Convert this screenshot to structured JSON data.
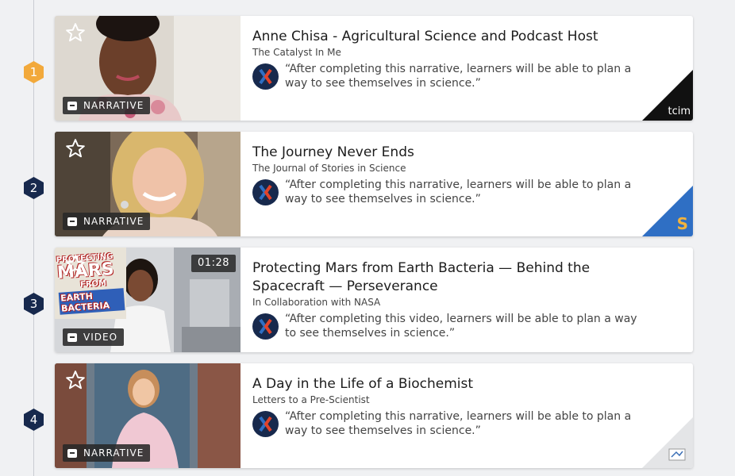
{
  "cards": [
    {
      "step": "1",
      "title": "Anne Chisa - Agricultural Science and Podcast Host",
      "source": "The Catalyst In Me",
      "objective": "“After completing this narrative, learners will be able to plan a way to see themselves in science.”",
      "type_label": "NARRATIVE",
      "corner_label": "tcim"
    },
    {
      "step": "2",
      "title": "The Journey Never Ends",
      "source": "The Journal of Stories in Science",
      "objective": "“After completing this narrative, learners will be able to plan a way to see themselves in science.”",
      "type_label": "NARRATIVE",
      "corner_label": "S"
    },
    {
      "step": "3",
      "title": "Protecting Mars from Earth Bacteria — Behind the Spacecraft — Perseverance",
      "source": "In Collaboration with NASA",
      "objective": "“After completing this video, learners will be able to plan a way to see themselves in science.”",
      "type_label": "VIDEO",
      "duration": "01:28",
      "poster_lines": [
        "PROTECTING",
        "MARS",
        "FROM",
        "EARTH BACTERIA"
      ]
    },
    {
      "step": "4",
      "title": "A Day in the Life of a Biochemist",
      "source": "Letters to a Pre-Scientist",
      "objective": "“After completing this narrative, learners will be able to plan a way to see themselves in science.”",
      "type_label": "NARRATIVE"
    }
  ],
  "colors": {
    "step_active": "#f2a93b",
    "step_default": "#17294d",
    "card_bg": "#ffffff",
    "page_bg": "#f0f1f3"
  },
  "icons": {
    "favorite": "star-outline-icon",
    "narrative": "chat-bubble-icon",
    "video": "video-camera-icon",
    "avatar": "x-logo-icon"
  }
}
